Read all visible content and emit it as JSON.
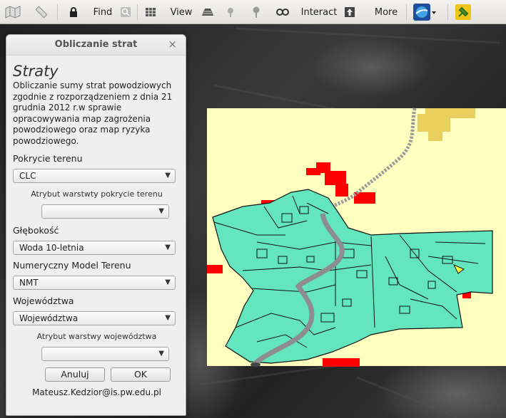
{
  "toolbar": {
    "find_label": "Find",
    "view_label": "View",
    "interact_label": "Interact",
    "more_label": "More",
    "icons": [
      "map-icon",
      "ruler-icon",
      "lock-icon",
      "search-icon",
      "grid-icon",
      "layers-icon",
      "pin-small-icon",
      "pin-icon",
      "link-icon",
      "export-icon",
      "globe-icon",
      "plugin-icon"
    ]
  },
  "dialog": {
    "title": "Obliczanie strat",
    "close": "×",
    "heading": "Straty",
    "description": "Obliczanie sumy strat powodziowych zgodnie z rozporządzeniem z dnia 21 grudnia 2012 r.w sprawie opracowywania map zagrożenia powodziowego oraz map ryzyka powodziowego.",
    "land_cover_label": "Pokrycie terenu",
    "land_cover_value": "CLC",
    "land_cover_attr_label": "Atrybut warstwty pokrycie terenu",
    "land_cover_attr_value": "",
    "depth_label": "Głębokość",
    "depth_value": "Woda 10-letnia",
    "dem_label": "Numeryczny Model Terenu",
    "dem_value": "NMT",
    "voivodeship_label": "Województwa",
    "voivodeship_value": "Województwa",
    "voivodeship_attr_label": "Atrybut warstwy województwa",
    "voivodeship_attr_value": "",
    "cancel_label": "Anuluj",
    "ok_label": "OK",
    "footer": "Mateusz.Kedzior@is.pw.edu.pl"
  },
  "colors": {
    "map_background": "#ffffc0",
    "land_polygon": "#63e6be",
    "risk_red": "#ff0000",
    "sand": "#e8cf5e",
    "river": "#9a9a9a"
  }
}
